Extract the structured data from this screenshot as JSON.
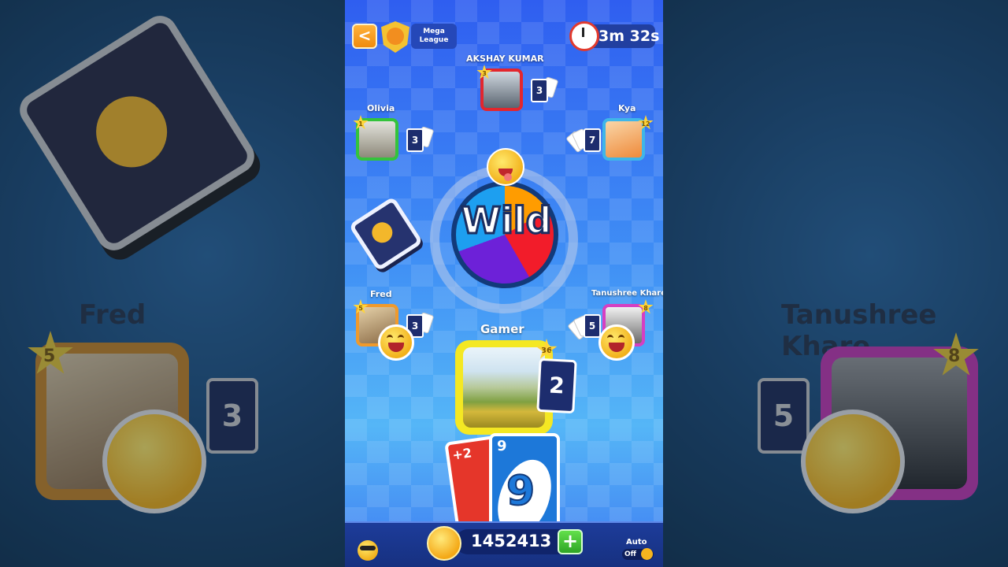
{
  "header": {
    "back_label": "<",
    "league_line1": "Mega",
    "league_line2": "League",
    "timer": "3m 32s"
  },
  "players": [
    {
      "name": "AKSHAY KUMAR",
      "level": "3",
      "cards": "3",
      "frame_color": "#e3262d"
    },
    {
      "name": "Olivia",
      "level": "1",
      "cards": "3",
      "frame_color": "#34c33c"
    },
    {
      "name": "Kya",
      "level": "12",
      "cards": "7",
      "frame_color": "#3fb6e8"
    },
    {
      "name": "Fred",
      "level": "5",
      "cards": "3",
      "frame_color": "#f09a2c"
    },
    {
      "name": "Tanushree Khare",
      "level": "8",
      "cards": "5",
      "frame_color": "#d63fc2"
    }
  ],
  "self": {
    "name": "Gamer",
    "level": "36",
    "cards": "2"
  },
  "center": {
    "wild_label": "Wild"
  },
  "hand": [
    {
      "label": "+2",
      "color": "#e5362a"
    },
    {
      "label": "9",
      "big": "9",
      "color": "#1d78d9"
    }
  ],
  "bottom": {
    "coins": "1452413",
    "add_label": "+",
    "auto_label": "Auto",
    "auto_state": "Off"
  },
  "backdrop": {
    "left_name": "Fred",
    "left_level": "5",
    "left_cards": "3",
    "right_name": "Tanushree Khare",
    "right_level": "8",
    "right_cards": "5"
  }
}
